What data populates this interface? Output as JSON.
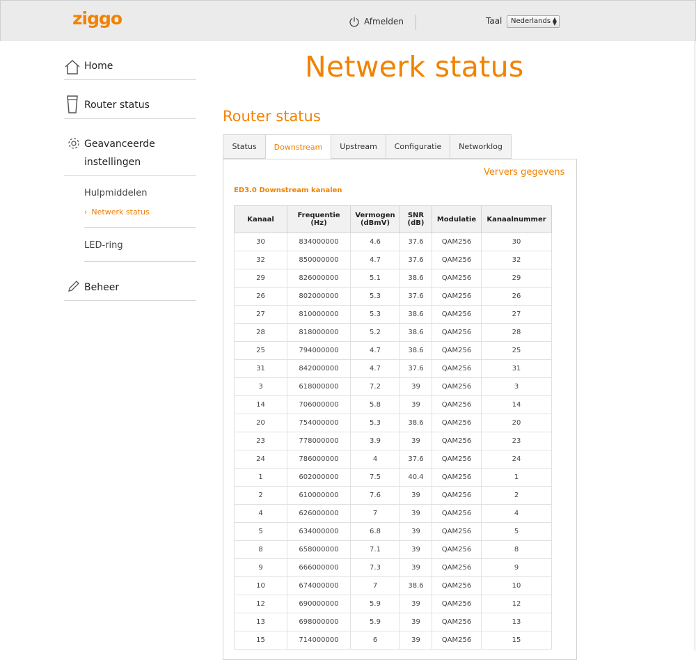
{
  "header": {
    "logo_text": "ziggo",
    "logout_label": "Afmelden",
    "language_label": "Taal",
    "language_value": "Nederlands"
  },
  "sidebar": {
    "home": "Home",
    "router_status": "Router status",
    "advanced_line1": "Geavanceerde",
    "advanced_line2": "instellingen",
    "tools": "Hulpmiddelen",
    "network_status": "Netwerk status",
    "led_ring": "LED-ring",
    "management": "Beheer"
  },
  "page_title": "Netwerk status",
  "section_title": "Router status",
  "tabs": [
    "Status",
    "Downstream",
    "Upstream",
    "Configuratie",
    "Networklog"
  ],
  "active_tab": "Downstream",
  "refresh_label": "Ververs gegevens",
  "table": {
    "title": "ED3.0 Downstream kanalen",
    "headers": [
      [
        "Kanaal"
      ],
      [
        "Frequentie",
        "(Hz)"
      ],
      [
        "Vermogen",
        "(dBmV)"
      ],
      [
        "SNR",
        "(dB)"
      ],
      [
        "Modulatie"
      ],
      [
        "Kanaalnummer"
      ]
    ],
    "rows": [
      [
        "30",
        "834000000",
        "4.6",
        "37.6",
        "QAM256",
        "30"
      ],
      [
        "32",
        "850000000",
        "4.7",
        "37.6",
        "QAM256",
        "32"
      ],
      [
        "29",
        "826000000",
        "5.1",
        "38.6",
        "QAM256",
        "29"
      ],
      [
        "26",
        "802000000",
        "5.3",
        "37.6",
        "QAM256",
        "26"
      ],
      [
        "27",
        "810000000",
        "5.3",
        "38.6",
        "QAM256",
        "27"
      ],
      [
        "28",
        "818000000",
        "5.2",
        "38.6",
        "QAM256",
        "28"
      ],
      [
        "25",
        "794000000",
        "4.7",
        "38.6",
        "QAM256",
        "25"
      ],
      [
        "31",
        "842000000",
        "4.7",
        "37.6",
        "QAM256",
        "31"
      ],
      [
        "3",
        "618000000",
        "7.2",
        "39",
        "QAM256",
        "3"
      ],
      [
        "14",
        "706000000",
        "5.8",
        "39",
        "QAM256",
        "14"
      ],
      [
        "20",
        "754000000",
        "5.3",
        "38.6",
        "QAM256",
        "20"
      ],
      [
        "23",
        "778000000",
        "3.9",
        "39",
        "QAM256",
        "23"
      ],
      [
        "24",
        "786000000",
        "4",
        "37.6",
        "QAM256",
        "24"
      ],
      [
        "1",
        "602000000",
        "7.5",
        "40.4",
        "QAM256",
        "1"
      ],
      [
        "2",
        "610000000",
        "7.6",
        "39",
        "QAM256",
        "2"
      ],
      [
        "4",
        "626000000",
        "7",
        "39",
        "QAM256",
        "4"
      ],
      [
        "5",
        "634000000",
        "6.8",
        "39",
        "QAM256",
        "5"
      ],
      [
        "8",
        "658000000",
        "7.1",
        "39",
        "QAM256",
        "8"
      ],
      [
        "9",
        "666000000",
        "7.3",
        "39",
        "QAM256",
        "9"
      ],
      [
        "10",
        "674000000",
        "7",
        "38.6",
        "QAM256",
        "10"
      ],
      [
        "12",
        "690000000",
        "5.9",
        "39",
        "QAM256",
        "12"
      ],
      [
        "13",
        "698000000",
        "5.9",
        "39",
        "QAM256",
        "13"
      ],
      [
        "15",
        "714000000",
        "6",
        "39",
        "QAM256",
        "15"
      ]
    ]
  },
  "colors": {
    "accent": "#f28200",
    "topbar_bg": "#ebebeb",
    "table_header_bg": "#f1f1f1"
  },
  "icons": {
    "logout": "power-icon",
    "home": "house-icon",
    "router": "router-icon",
    "settings": "gear-icon",
    "submenu_marker": "chevron-right-icon",
    "management": "pencil-icon"
  }
}
